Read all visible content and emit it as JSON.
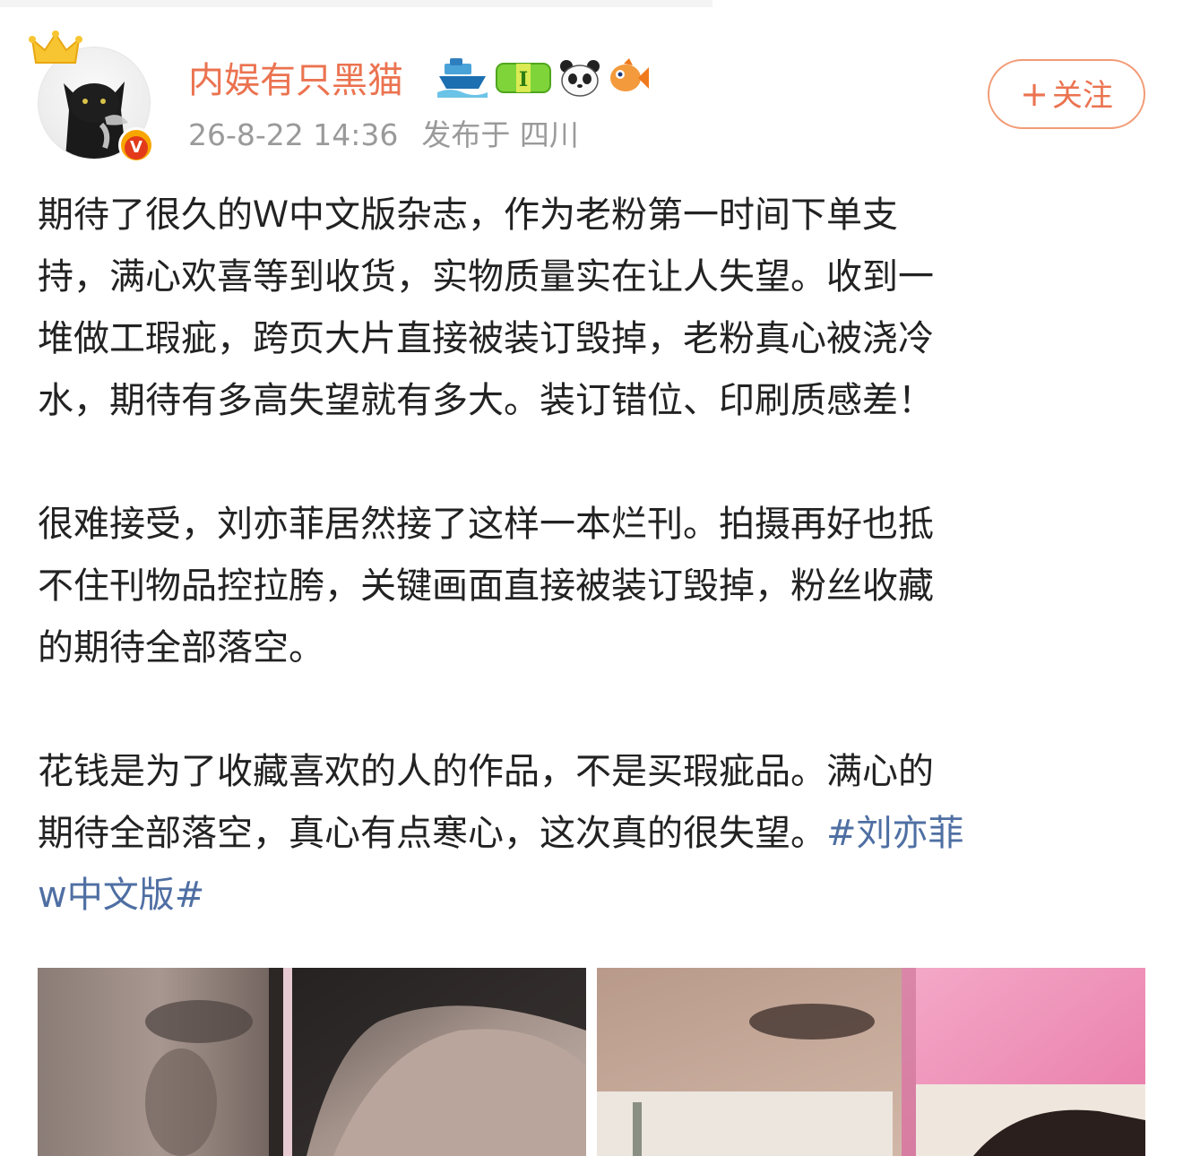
{
  "post": {
    "author": {
      "name": "内娱有只黑猫",
      "avatar_icon": "black-cat-avatar-icon",
      "crown_icon": "crown-icon",
      "verified_badge": "V",
      "badges": [
        "boat-badge-icon",
        "level-badge-icon",
        "panda-icon",
        "fish-icon"
      ],
      "level_label": "I"
    },
    "time": "26-8-22 14:36",
    "location": "发布于 四川",
    "follow_label": "+关注",
    "follow_plus": "+",
    "follow_text": "关注",
    "paragraphs": [
      {
        "lines": [
          "期待了很久的Ｗ中文版杂志，作为老粉第一时间下单支",
          "持，满心欢喜等到收货，实物质量实在让人失望。收到一",
          "堆做工瑕疵，跨页大片直接被装订毁掉，老粉真心被浇冷",
          "水，期待有多高失望就有多大。装订错位、印刷质感差！"
        ]
      },
      {
        "lines": [
          "很难接受，刘亦菲居然接了这样一本烂刊。拍摄再好也抵",
          "不住刊物品控拉胯，关键画面直接被装订毁掉，粉丝收藏",
          "的期待全部落空。"
        ]
      },
      {
        "lines": [
          "花钱是为了收藏喜欢的人的作品，不是买瑕疵品。满心的",
          "期待全部落空，真心有点寒心，这次真的很失望。"
        ],
        "hashtag_part1": "#刘亦菲",
        "hashtag_part2": "w中文版#"
      }
    ],
    "images": [
      "magazine-spread-photo-1",
      "magazine-spread-photo-2"
    ]
  },
  "colors": {
    "username": "#eb7350",
    "hashtag": "#4f6fa3",
    "meta": "#9a9a9a",
    "follow_border": "#f29b76",
    "text": "#222222"
  }
}
